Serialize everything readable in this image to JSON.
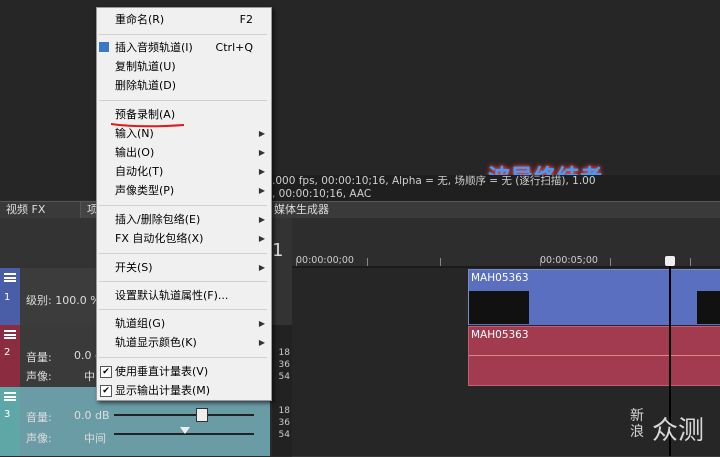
{
  "preview": {
    "info_line1": ".000 fps, 00:00:10;16, Alpha = 无, 场顺序 = 无 (逐行扫描), 1.00",
    "info_line2": ", 00:00:10;16, AAC",
    "overlay_title": "波导终结者"
  },
  "tabs": [
    {
      "label": "视频 FX"
    },
    {
      "label": "项"
    },
    {
      "label": "媒体生成器"
    }
  ],
  "ruler": {
    "marker_label": "1",
    "time_start": "00:00:00;00",
    "time_mid": "00:00:05;00"
  },
  "tracks": [
    {
      "number": "1",
      "label_level": "级别: 100.0 %",
      "clip_name": "MAH05363",
      "color": "#4a5ea8"
    },
    {
      "number": "2",
      "label_volume": "音量:",
      "volume_value": "0.0 c",
      "label_pan": "声像:",
      "pan_value": "中",
      "clip_name": "MAH05363",
      "color": "#8b2c40"
    },
    {
      "number": "3",
      "label_volume": "音量:",
      "volume_value": "0.0 dB",
      "label_pan": "声像:",
      "pan_value": "中间",
      "color": "#5fa6a6"
    }
  ],
  "meter_labels": {
    "t2": [
      "18",
      "36",
      "54"
    ],
    "t3": [
      "18",
      "36",
      "54"
    ]
  },
  "context_menu": {
    "rename": {
      "label": "重命名(R)",
      "shortcut": "F2"
    },
    "insert_audio": {
      "label": "插入音频轨道(I)",
      "shortcut": "Ctrl+Q"
    },
    "duplicate": {
      "label": "复制轨道(U)"
    },
    "delete": {
      "label": "删除轨道(D)"
    },
    "arm": {
      "label": "预备录制(A)"
    },
    "input": {
      "label": "输入(N)"
    },
    "output": {
      "label": "输出(O)"
    },
    "automation": {
      "label": "自动化(T)"
    },
    "sound_type": {
      "label": "声像类型(P)"
    },
    "insert_envelope": {
      "label": "插入/删除包络(E)"
    },
    "fx_envelope": {
      "label": "FX 自动化包络(X)"
    },
    "switches": {
      "label": "开关(S)"
    },
    "default_props": {
      "label": "设置默认轨道属性(F)..."
    },
    "track_group": {
      "label": "轨道组(G)"
    },
    "track_color": {
      "label": "轨道显示颜色(K)"
    },
    "vertical_meter": {
      "label": "使用垂直计量表(V)",
      "checked": true
    },
    "output_meter": {
      "label": "显示输出计量表(M)",
      "checked": true
    }
  },
  "watermark": {
    "line1": "新",
    "line2": "浪",
    "brand": "众测"
  }
}
